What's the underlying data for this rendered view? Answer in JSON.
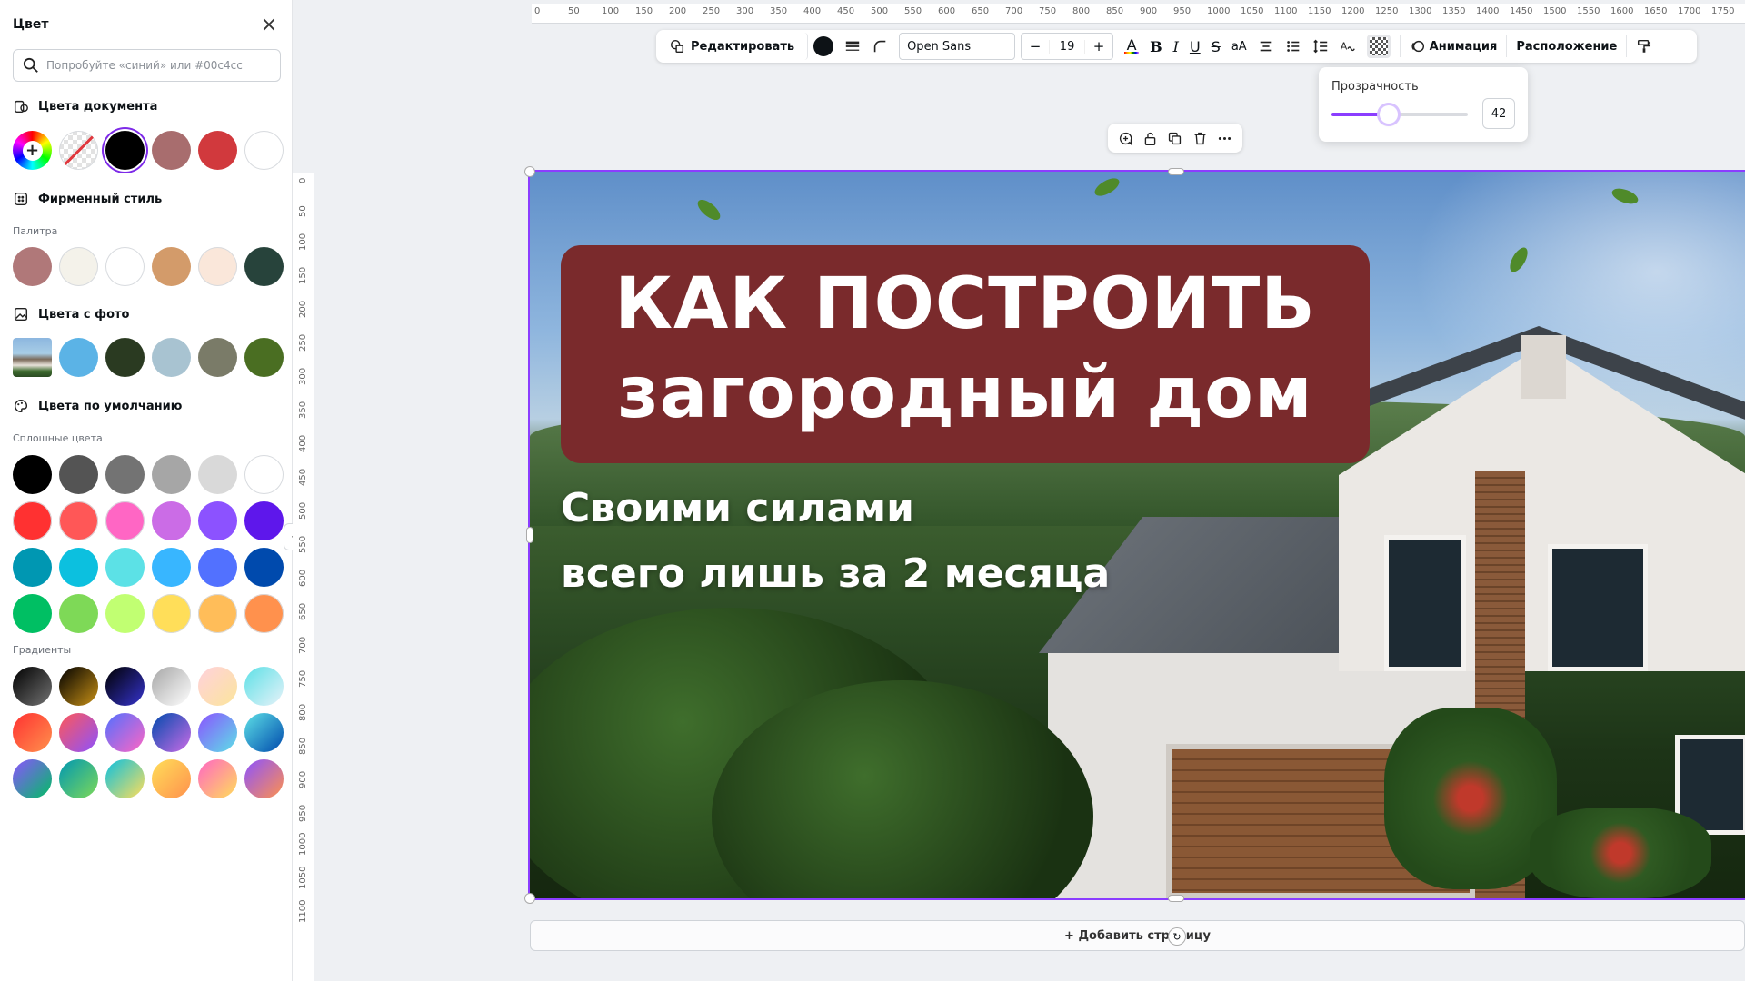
{
  "panel": {
    "title": "Цвет",
    "search_placeholder": "Попробуйте «синий» или #00c4cc",
    "document_colors": {
      "label": "Цвета документа",
      "swatches": [
        "#000000",
        "#a86d6e",
        "#d1393d",
        "#ffffff"
      ]
    },
    "brand": {
      "label": "Фирменный стиль",
      "palette_label": "Палитра",
      "swatches": [
        "#b07879",
        "#f4f2ea",
        "#ffffff",
        "#d39b6a",
        "#fae7da",
        "#27433b"
      ]
    },
    "photo_colors": {
      "label": "Цвета с фото",
      "swatches": [
        "#5bb3e6",
        "#2a3a21",
        "#a8c3d1",
        "#7a7b68",
        "#4a6e22"
      ]
    },
    "default_colors": {
      "label": "Цвета по умолчанию",
      "solid_label": "Сплошные цвета",
      "solid_rows": [
        [
          "#000000",
          "#545454",
          "#737373",
          "#a6a6a6",
          "#d9d9d9",
          "#ffffff"
        ],
        [
          "#ff3131",
          "#ff5757",
          "#ff66c4",
          "#cb6ce6",
          "#8c52ff",
          "#5e17eb"
        ],
        [
          "#0097b2",
          "#0cc0df",
          "#5ce1e6",
          "#38b6ff",
          "#5271ff",
          "#004aad"
        ],
        [
          "#00bf63",
          "#7ed957",
          "#c1ff72",
          "#ffde59",
          "#ffbd59",
          "#ff914d"
        ]
      ],
      "gradient_label": "Градиенты",
      "gradient_rows": [
        [
          [
            "#000000",
            "#737373"
          ],
          [
            "#000000",
            "#c89116"
          ],
          [
            "#000000",
            "#3533cd"
          ],
          [
            "#a6a6a6",
            "#ffffff"
          ],
          [
            "#ffd1dc",
            "#fbe59b"
          ],
          [
            "#5de0e6",
            "#e7f2f9"
          ]
        ],
        [
          [
            "#ff3131",
            "#ff914d"
          ],
          [
            "#ff5757",
            "#8c52ff"
          ],
          [
            "#5170ff",
            "#ff66c4"
          ],
          [
            "#004aad",
            "#cb6ce6"
          ],
          [
            "#8c52ff",
            "#5ce1e6"
          ],
          [
            "#5de0e6",
            "#004aad"
          ]
        ],
        [
          [
            "#8c52ff",
            "#00bf63"
          ],
          [
            "#0097b2",
            "#7ed957"
          ],
          [
            "#0cc0df",
            "#ffde59"
          ],
          [
            "#ffde59",
            "#ff914d"
          ],
          [
            "#ff66c4",
            "#ffde59"
          ],
          [
            "#8c52ff",
            "#ff914d"
          ]
        ]
      ]
    }
  },
  "ruler_top": [
    "0",
    "50",
    "100",
    "150",
    "200",
    "250",
    "300",
    "350",
    "400",
    "450",
    "500",
    "550",
    "600",
    "650",
    "700",
    "750",
    "800",
    "850",
    "900",
    "950",
    "1000",
    "1050",
    "1100",
    "1150",
    "1200",
    "1250",
    "1300",
    "1350",
    "1400",
    "1450",
    "1500",
    "1550",
    "1600",
    "1650",
    "1700",
    "1750"
  ],
  "ruler_left": [
    "0",
    "50",
    "100",
    "150",
    "200",
    "250",
    "300",
    "350",
    "400",
    "450",
    "500",
    "550",
    "600",
    "650",
    "700",
    "750",
    "800",
    "850",
    "900",
    "950",
    "1000",
    "1050",
    "1100"
  ],
  "toolbar": {
    "edit_label": "Редактировать",
    "text_color": "#0d1216",
    "font": "Open Sans",
    "font_size": "19",
    "minus": "−",
    "plus": "+",
    "case_label": "aA",
    "animation_label": "Анимация",
    "position_label": "Расположение"
  },
  "transparency": {
    "label": "Прозрачность",
    "value": 42,
    "accent": "#8b3dff"
  },
  "design": {
    "title_line1": "КАК ПОСТРОИТЬ",
    "title_line2": "загородный дом",
    "subtitle_line1": "Своими силами",
    "subtitle_line2": "всего лишь за 2 месяца",
    "title_bg": "#7a2a2c"
  },
  "add_page_label": "+ Добавить страницу"
}
